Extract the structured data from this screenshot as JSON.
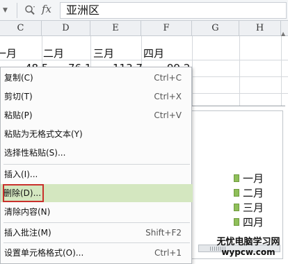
{
  "formula_bar": {
    "fx_label": "fx",
    "value": "亚洲区",
    "icons": [
      "dropdown-icon",
      "zoom-icon",
      "fx-icon"
    ]
  },
  "columns": [
    "C",
    "D",
    "E",
    "F",
    "G",
    "H"
  ],
  "row_headers_visible": [
    "一月",
    "二月",
    "三月",
    "四月"
  ],
  "partial_values": [
    "48.5",
    "76.1",
    "113.7",
    "99.2"
  ],
  "context_menu": {
    "items": [
      {
        "label": "复制(C)",
        "shortcut": "Ctrl+C"
      },
      {
        "label": "剪切(T)",
        "shortcut": "Ctrl+X"
      },
      {
        "label": "粘贴(P)",
        "shortcut": "Ctrl+V"
      },
      {
        "label": "粘贴为无格式文本(Y)",
        "shortcut": ""
      },
      {
        "label": "选择性粘贴(S)...",
        "shortcut": ""
      },
      {
        "label": "插入(I)...",
        "shortcut": ""
      },
      {
        "label": "删除(D)...",
        "shortcut": ""
      },
      {
        "label": "清除内容(N)",
        "shortcut": ""
      },
      {
        "label": "插入批注(M)",
        "shortcut": "Shift+F2"
      },
      {
        "label": "设置单元格格式(O)...",
        "shortcut": "Ctrl+1"
      }
    ],
    "highlighted_index": 6,
    "highlight_color": "#d4e7c0",
    "highlight_border_color": "#c9302c"
  },
  "chart": {
    "legend": [
      "一月",
      "二月",
      "三月",
      "四月"
    ],
    "legend_color": "#8fbf5a"
  },
  "watermark": {
    "line1": "无忧电脑学习网",
    "line2": "wypcw.com"
  }
}
